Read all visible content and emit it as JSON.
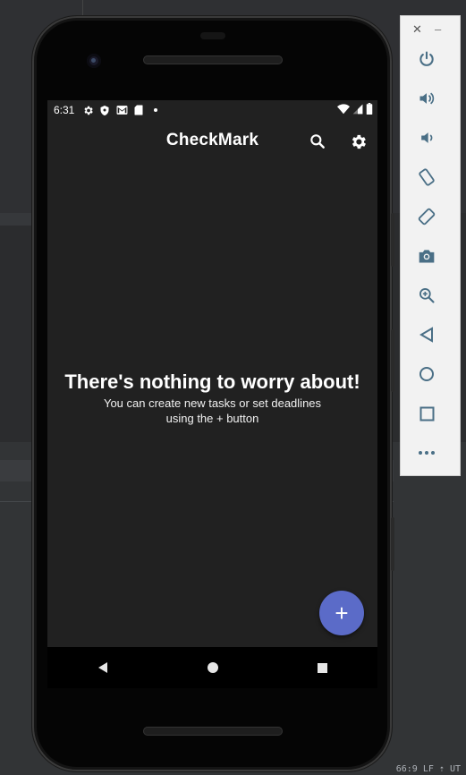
{
  "statusbar": {
    "time": "6:31",
    "icons": [
      "settings-icon",
      "shield-icon",
      "gmail-icon",
      "sd-card-icon",
      "dot-icon"
    ],
    "right_icons": [
      "wifi-icon",
      "signal-icon",
      "battery-icon"
    ]
  },
  "appbar": {
    "title": "CheckMark",
    "actions": [
      "search-icon",
      "settings-icon"
    ]
  },
  "empty_state": {
    "title": "There's nothing to worry about!",
    "subtitle": "You can create new tasks or set deadlines using the + button"
  },
  "fab": {
    "label": "+",
    "color": "#5b6bc8"
  },
  "navbar": {
    "buttons": [
      "back",
      "home",
      "recents"
    ]
  },
  "emulator_toolbar": {
    "close": "✕",
    "minimize": "–",
    "buttons": [
      "power",
      "volume-up",
      "volume-down",
      "rotate-left",
      "rotate-right",
      "screenshot",
      "zoom",
      "back",
      "home",
      "overview",
      "more"
    ],
    "icon_color": "#4a6f86"
  },
  "ide": {
    "status_hint": "66:9  LF ⇡  UT"
  },
  "colors": {
    "screen_bg": "#212121",
    "accent": "#5b6bc8",
    "text": "#ffffff"
  }
}
